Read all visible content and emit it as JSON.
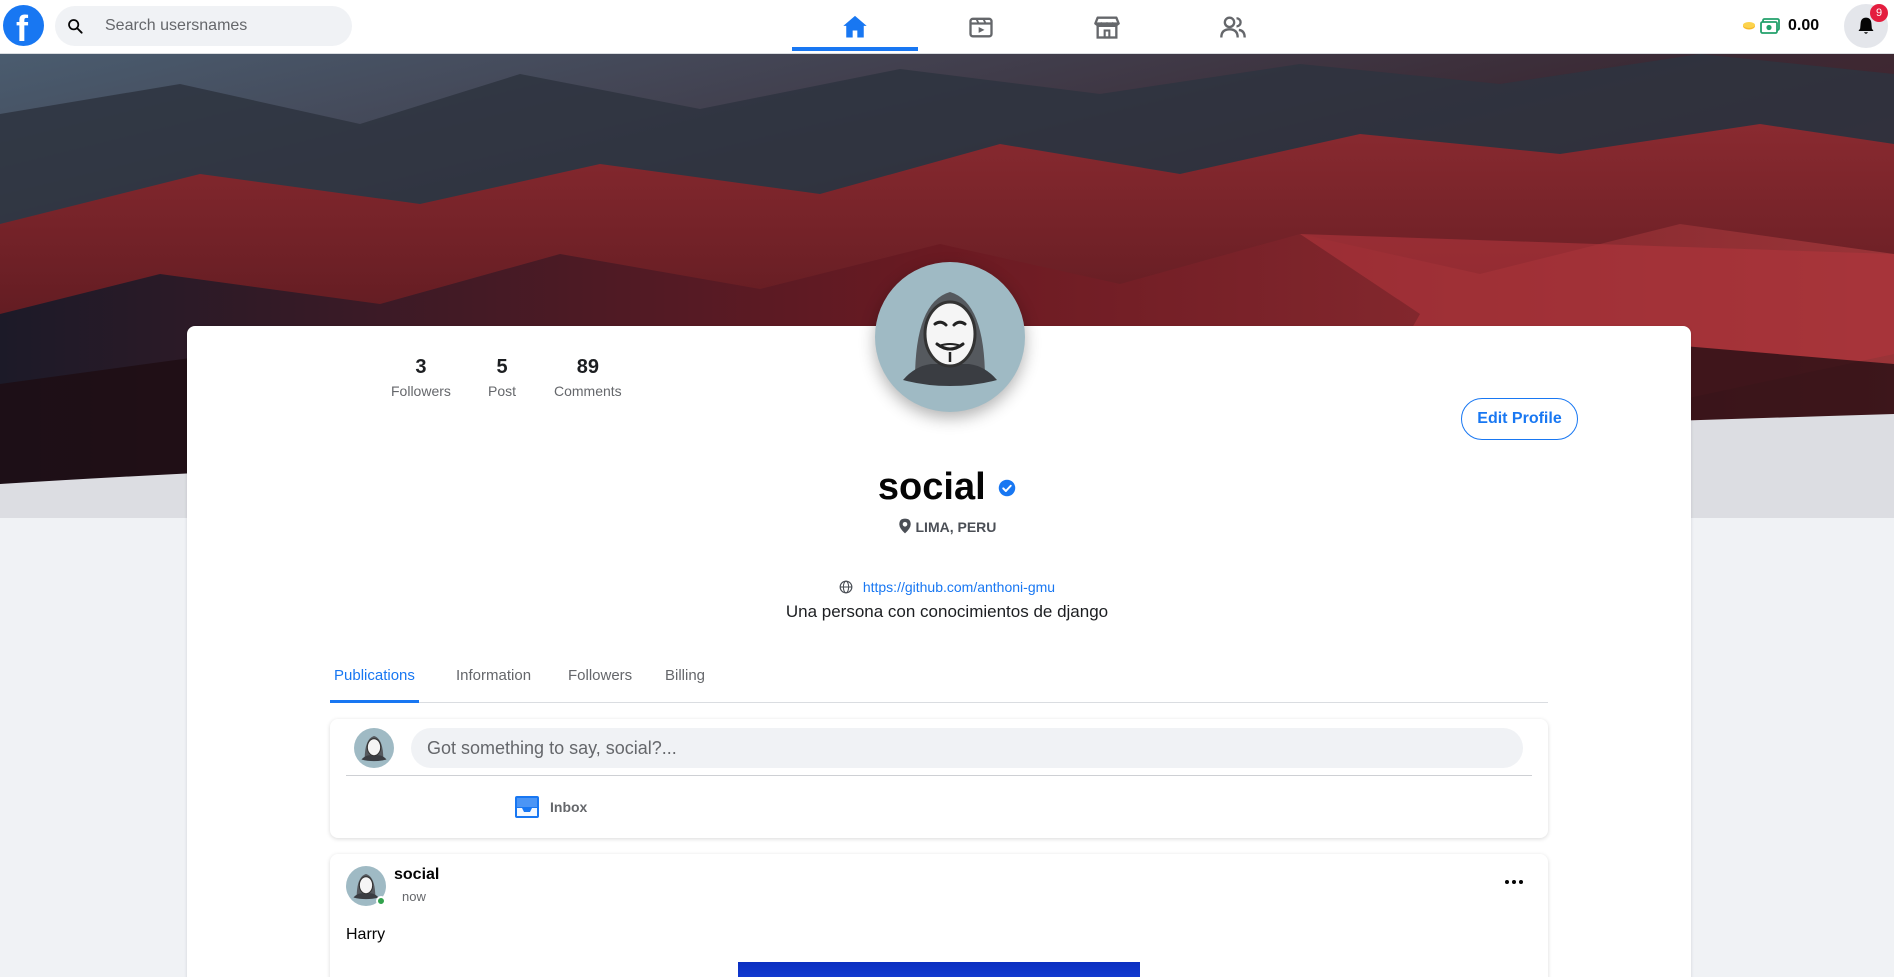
{
  "navbar": {
    "logo_letter": "f",
    "search": {
      "placeholder": "Search usersnames",
      "value": ""
    },
    "tabs": [
      {
        "name": "home",
        "icon": "home-icon",
        "active": true
      },
      {
        "name": "videos",
        "icon": "video-icon",
        "active": false
      },
      {
        "name": "marketplace",
        "icon": "store-icon",
        "active": false
      },
      {
        "name": "friends",
        "icon": "friends-icon",
        "active": false
      }
    ],
    "wallet_amount": "0.00",
    "notifications_count": "9"
  },
  "profile": {
    "stats": [
      {
        "value": "3",
        "label": "Followers"
      },
      {
        "value": "5",
        "label": "Post"
      },
      {
        "value": "89",
        "label": "Comments"
      }
    ],
    "edit_label": "Edit Profile",
    "name": "social",
    "location": "LIMA, PERU",
    "website": "https://github.com/anthoni-gmu",
    "bio": "Una persona con conocimientos de django"
  },
  "profile_tabs": [
    "Publications",
    "Information",
    "Followers",
    "Billing"
  ],
  "composer": {
    "placeholder": "Got something to say, social?...",
    "inbox_label": "Inbox"
  },
  "post": {
    "author": "social",
    "time": "now",
    "text": "Harry"
  },
  "colors": {
    "accent": "#1877f2",
    "online": "#31a24c",
    "badge": "#e41e3f"
  }
}
